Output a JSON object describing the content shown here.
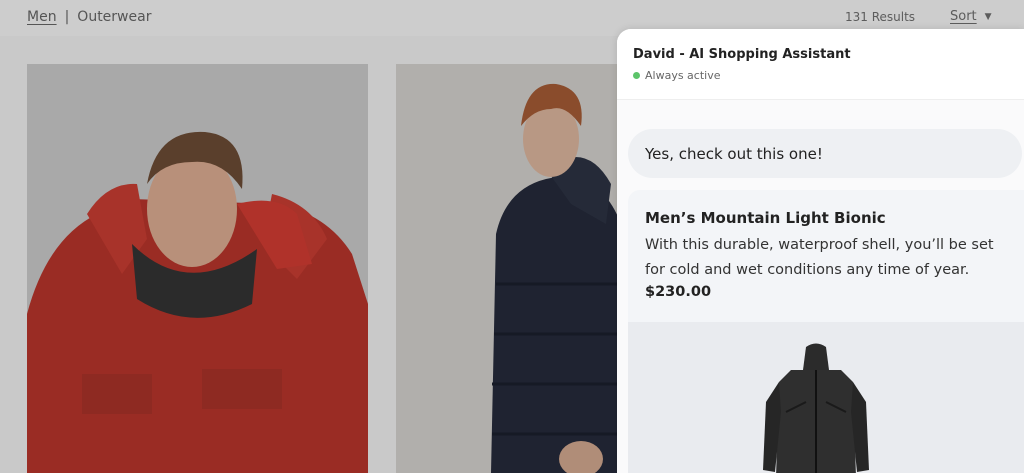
{
  "breadcrumb": {
    "category": "Men",
    "separator": "|",
    "subcategory": "Outerwear"
  },
  "listing": {
    "results": "131 Results",
    "sort_label": "Sort",
    "sort_icon": "chevron-down-icon"
  },
  "tiles": [
    {
      "alt": "man-in-red-parka"
    },
    {
      "alt": "man-in-navy-puffer"
    }
  ],
  "chat": {
    "agent_name": "David - AI Shopping Assistant",
    "status": "Always active",
    "status_color": "#5cc46a",
    "message": "Yes, check out this one!",
    "product": {
      "title": "Men’s Mountain Light Bionic",
      "description": "With this durable, waterproof shell, you’ll be set for cold and wet conditions any time of year.",
      "price": "$230.00"
    }
  },
  "colors": {
    "overlay_gray": "#c9c9c9",
    "parka_red": "#b0322a",
    "puffer_navy": "#1e2230",
    "shell_black": "#2b2b2b"
  }
}
